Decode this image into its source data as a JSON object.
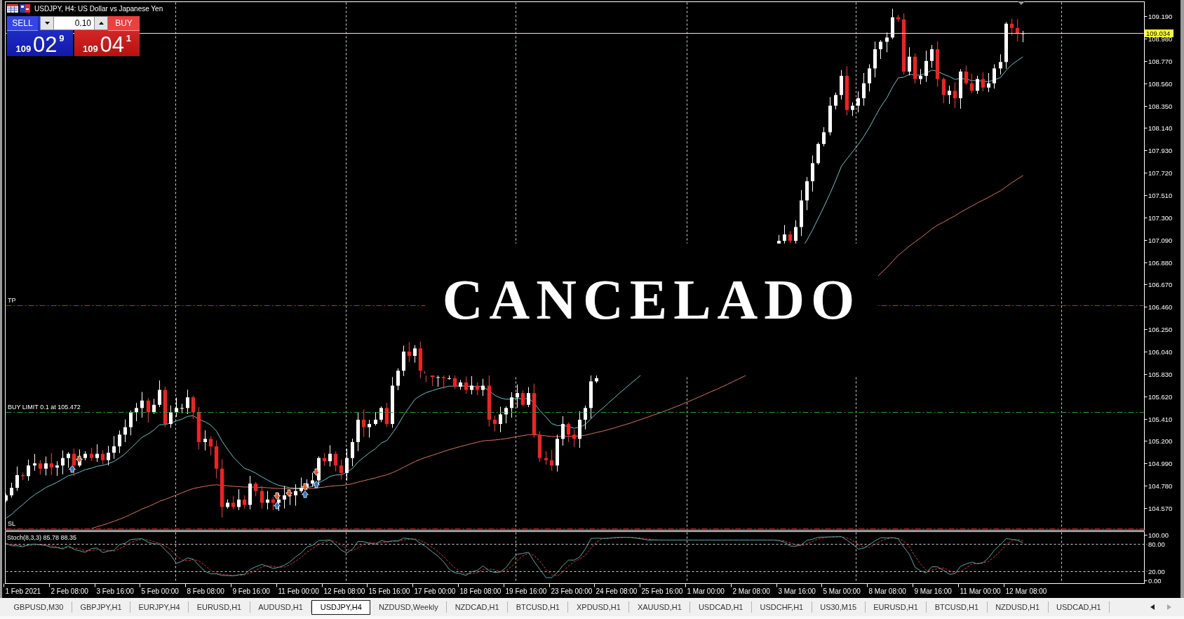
{
  "chart_window": {
    "title": "USDJPY, H4: US Dollar vs Japanese Yen",
    "one_click_trading": {
      "sell": {
        "label": "SELL",
        "big_figure": "109",
        "pips": "02",
        "point": "9"
      },
      "lot_size": "0.10",
      "buy": {
        "label": "BUY",
        "big_figure": "109",
        "pips": "04",
        "point": "1"
      }
    },
    "order_lines": [
      {
        "kind": "take_profit",
        "label": "TP"
      },
      {
        "kind": "pending_order",
        "label": "BUY LIMIT 0.1 at 105.472"
      },
      {
        "kind": "stop_loss",
        "label": "SL"
      },
      {
        "kind": "bid",
        "label": "109.034"
      }
    ],
    "price_axis": [
      "109.190",
      "108.980",
      "108.770",
      "108.560",
      "108.350",
      "108.140",
      "107.930",
      "107.720",
      "107.510",
      "107.300",
      "107.090",
      "106.880",
      "106.670",
      "106.460",
      "106.250",
      "106.040",
      "105.830",
      "105.620",
      "105.410",
      "105.200",
      "104.990",
      "104.780",
      "104.570"
    ],
    "overlay_text": "CANCELADO",
    "stochastic": {
      "label": "Stoch(8,3,3) 85.78 88.35",
      "axis": [
        "100.00",
        "80.00",
        "20.00",
        "0.00"
      ]
    },
    "time_axis": [
      "1 Feb 2021",
      "2 Feb 08:00",
      "3 Feb 16:00",
      "5 Feb 00:00",
      "8 Feb 08:00",
      "9 Feb 16:00",
      "11 Feb 00:00",
      "12 Feb 08:00",
      "15 Feb 16:00",
      "17 Feb 00:00",
      "18 Feb 08:00",
      "19 Feb 16:00",
      "23 Feb 00:00",
      "24 Feb 08:00",
      "25 Feb 16:00",
      "1 Mar 00:00",
      "2 Mar 08:00",
      "3 Mar 16:00",
      "5 Mar 00:00",
      "8 Mar 08:00",
      "9 Mar 16:00",
      "11 Mar 00:00",
      "12 Mar 08:00"
    ]
  },
  "symbol_tabs": [
    {
      "label": "GBPUSD,M30",
      "selected": false
    },
    {
      "label": "GBPJPY,H1",
      "selected": false
    },
    {
      "label": "EURJPY,H4",
      "selected": false
    },
    {
      "label": "EURUSD,H1",
      "selected": false
    },
    {
      "label": "AUDUSD,H1",
      "selected": false
    },
    {
      "label": "USDJPY,H4",
      "selected": true
    },
    {
      "label": "NZDUSD,Weekly",
      "selected": false
    },
    {
      "label": "NZDCAD,H1",
      "selected": false
    },
    {
      "label": "BTCUSD,H1",
      "selected": false
    },
    {
      "label": "XPDUSD,H1",
      "selected": false
    },
    {
      "label": "XAUUSD,H1",
      "selected": false
    },
    {
      "label": "USDCAD,H1",
      "selected": false
    },
    {
      "label": "USDCHF,H1",
      "selected": false
    },
    {
      "label": "US30,M15",
      "selected": false
    },
    {
      "label": "EURUSD,H1",
      "selected": false
    },
    {
      "label": "BTCUSD,H1",
      "selected": false
    },
    {
      "label": "NZDUSD,H1",
      "selected": false
    },
    {
      "label": "USDCAD,H1",
      "selected": false
    }
  ],
  "tab_scroll": [
    {
      "kind": "left",
      "disabled": false
    },
    {
      "kind": "right",
      "disabled": true
    }
  ]
}
